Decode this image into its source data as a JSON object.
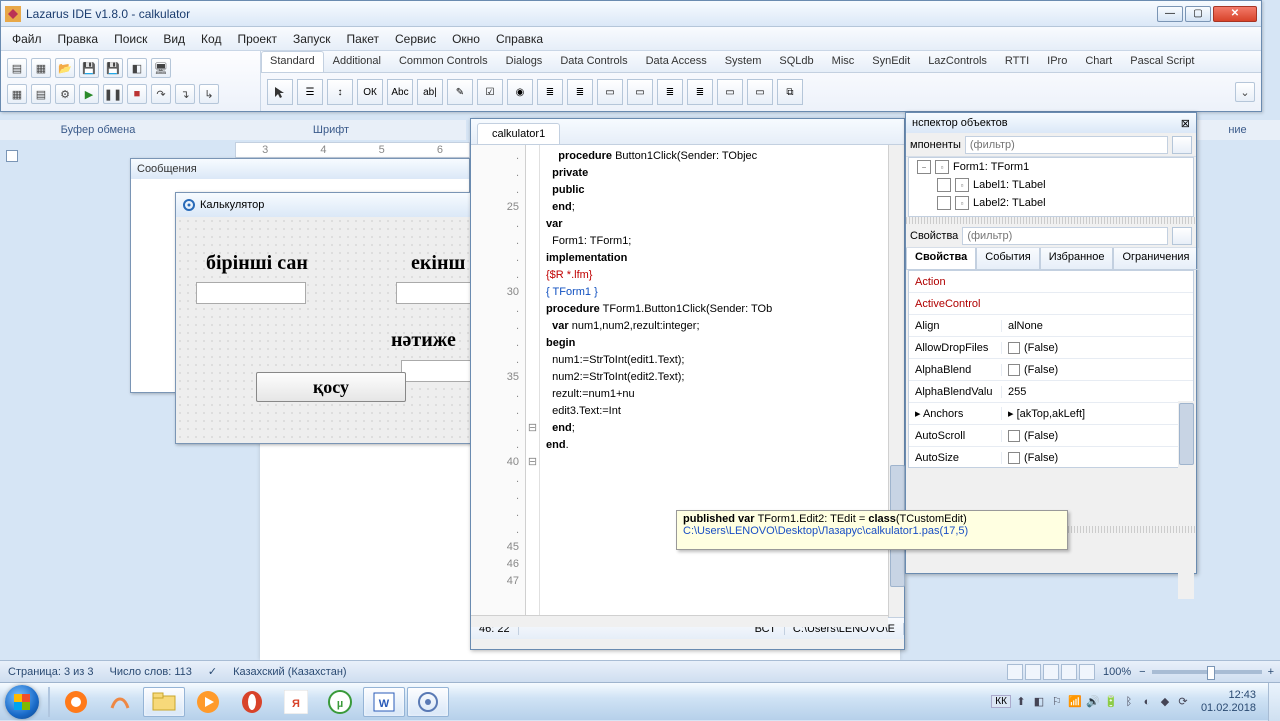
{
  "ide": {
    "title": "Lazarus IDE v1.8.0 - calkulator",
    "menu": [
      "Файл",
      "Правка",
      "Поиск",
      "Вид",
      "Код",
      "Проект",
      "Запуск",
      "Пакет",
      "Сервис",
      "Окно",
      "Справка"
    ],
    "component_tabs": [
      "Standard",
      "Additional",
      "Common Controls",
      "Dialogs",
      "Data Controls",
      "Data Access",
      "System",
      "SQLdb",
      "Misc",
      "SynEdit",
      "LazControls",
      "RTTI",
      "IPro",
      "Chart",
      "Pascal Script"
    ],
    "active_comp_tab": "Standard",
    "palette_items": [
      "☰",
      "↕",
      "ОК",
      "Abc",
      "ab|",
      "✎",
      "☑",
      "◉",
      "≣",
      "≣",
      "▭",
      "▭",
      "≣",
      "≣",
      "▭",
      "▭",
      "⧉"
    ]
  },
  "word": {
    "panel_clipboard": "Буфер обмена",
    "panel_font": "Шрифт",
    "panel_edit": "ние",
    "status_page": "Страница: 3 из 3",
    "status_words": "Число слов: 113",
    "status_lang": "Казахский (Казахстан)",
    "status_zoom": "100%"
  },
  "messages": {
    "title": "Сообщения"
  },
  "form": {
    "title": "Калькулятор",
    "label1": "бірінші  сан",
    "label2": "екінш",
    "label3": "нәтиже",
    "button": "қосу"
  },
  "source": {
    "tab": "calkulator1",
    "gutter": ".\n.\n.\n25\n.\n.\n.\n.\n30\n.\n.\n.\n.\n35\n.\n.\n.\n.\n40\n.\n.\n.\n.\n45\n46\n47",
    "lines": [
      {
        "indent": 4,
        "t": "    procedure Button1Click(Sender: TObjec",
        "kw": [
          "procedure"
        ]
      },
      {
        "indent": 2,
        "t": "  private",
        "kw": [
          "private"
        ]
      },
      {
        "indent": 0,
        "t": ""
      },
      {
        "indent": 2,
        "t": "  public",
        "kw": [
          "public"
        ]
      },
      {
        "indent": 0,
        "t": ""
      },
      {
        "indent": 2,
        "t": "  end;",
        "kw": [
          "end"
        ]
      },
      {
        "indent": 0,
        "t": ""
      },
      {
        "indent": 0,
        "t": "var",
        "kw": [
          "var"
        ]
      },
      {
        "indent": 2,
        "t": "  Form1: TForm1;"
      },
      {
        "indent": 0,
        "t": ""
      },
      {
        "indent": 0,
        "t": "implementation",
        "kw": [
          "implementation"
        ]
      },
      {
        "indent": 0,
        "t": ""
      },
      {
        "indent": 0,
        "cls": "dir",
        "t": "{$R *.lfm}"
      },
      {
        "indent": 0,
        "t": ""
      },
      {
        "indent": 0,
        "cls": "cm",
        "t": "{ TForm1 }"
      },
      {
        "indent": 0,
        "t": ""
      },
      {
        "indent": 0,
        "t": "procedure TForm1.Button1Click(Sender: TOb",
        "kw": [
          "procedure"
        ]
      },
      {
        "indent": 2,
        "t": "  var num1,num2,rezult:integer;",
        "kw": [
          "var"
        ]
      },
      {
        "indent": 0,
        "t": "begin",
        "kw": [
          "begin"
        ]
      },
      {
        "indent": 2,
        "t": "  num1:=StrToInt(edit1.Text);"
      },
      {
        "indent": 2,
        "t": "  num2:=StrToInt(edit2.Text);"
      },
      {
        "indent": 2,
        "t": "  rezult:=num1+nu"
      },
      {
        "indent": 2,
        "t": "  edit3.Text:=Int"
      },
      {
        "indent": 2,
        "t": "  end;",
        "kw": [
          "end"
        ]
      },
      {
        "indent": 0,
        "t": "end.",
        "kw": [
          "end"
        ]
      },
      {
        "indent": 0,
        "t": ""
      }
    ],
    "status_pos": "46: 22",
    "status_mode": "ВСТ",
    "status_path": "C:\\Users\\LENOVO\\E"
  },
  "tooltip": {
    "line1_pre": "published var ",
    "line1_mid": "TForm1.Edit2: TEdit = ",
    "line1_post": "class",
    "line1_end": "(TCustomEdit)",
    "line2": "C:\\Users\\LENOVO\\Desktop\\Лазарус\\calkulator1.pas(17,5)"
  },
  "oi": {
    "title": "нспектор объектов",
    "comp_label": "мпоненты",
    "filter_ph": "(фильтр)",
    "tree": [
      {
        "l": 1,
        "t": "Form1: TForm1"
      },
      {
        "l": 2,
        "t": "Label1: TLabel"
      },
      {
        "l": 2,
        "t": "Label2: TLabel"
      }
    ],
    "props_label": "Свойства",
    "tabs": [
      "Свойства",
      "События",
      "Избранное",
      "Ограничения"
    ],
    "active_tab": "Свойства",
    "rows": [
      {
        "n": "Action",
        "v": "",
        "red": true
      },
      {
        "n": "ActiveControl",
        "v": "",
        "red": true
      },
      {
        "n": "Align",
        "v": "alNone"
      },
      {
        "n": "AllowDropFiles",
        "v": "(False)",
        "chk": true
      },
      {
        "n": "AlphaBlend",
        "v": "(False)",
        "chk": true
      },
      {
        "n": "AlphaBlendValu",
        "v": "255"
      },
      {
        "n": "Anchors",
        "v": "[akTop,akLeft]",
        "exp": true
      },
      {
        "n": "AutoScroll",
        "v": "(False)",
        "chk": true
      },
      {
        "n": "AutoSize",
        "v": "(False)",
        "chk": true
      }
    ]
  },
  "taskbar": {
    "lang": "КК",
    "time": "12:43",
    "date": "01.02.2018"
  }
}
